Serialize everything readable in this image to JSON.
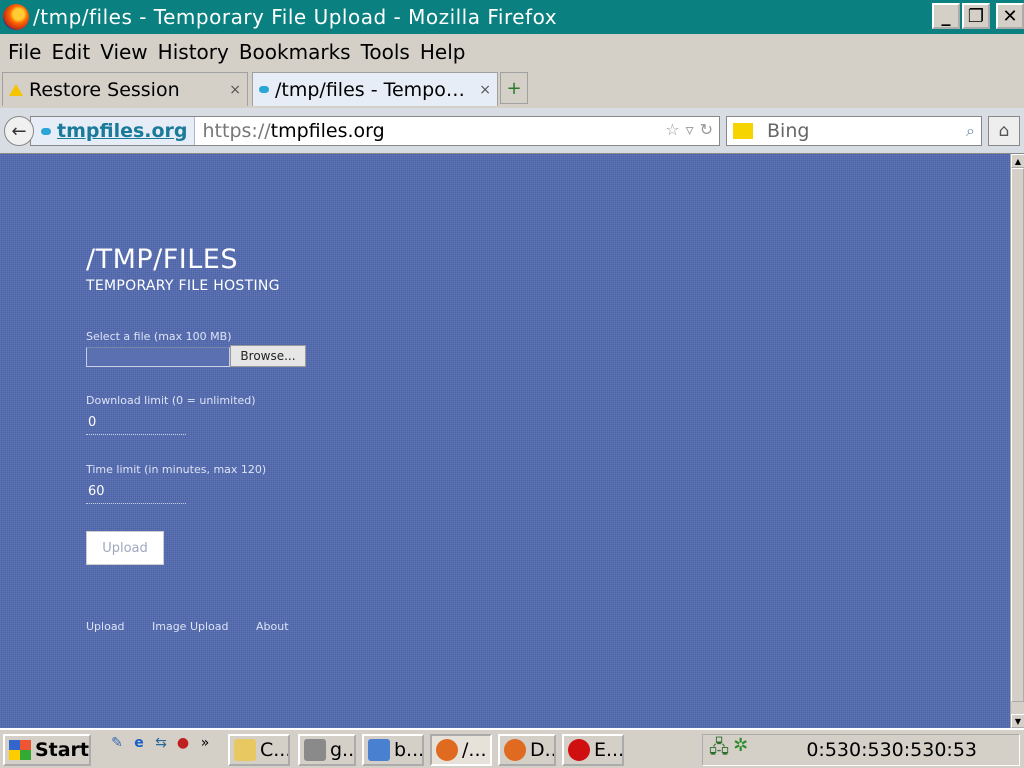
{
  "window": {
    "title": "/tmp/files - Temporary File Upload - Mozilla Firefox",
    "minimize": "_",
    "maximize": "❐",
    "close": "✕"
  },
  "menu": [
    "File",
    "Edit",
    "View",
    "History",
    "Bookmarks",
    "Tools",
    "Help"
  ],
  "tabs": [
    {
      "label": "Restore Session",
      "icon": "warning-icon",
      "close": "×",
      "active": false
    },
    {
      "label": "/tmp/files - Tempo…",
      "icon": "cloud-icon",
      "close": "×",
      "active": true
    }
  ],
  "new_tab": "+",
  "urlbar": {
    "identity": "tmpfiles.org",
    "scheme": "https://",
    "host": "tmpfiles.org"
  },
  "search": {
    "placeholder": "Bing"
  },
  "page": {
    "title": "/TMP/FILES",
    "subtitle": "TEMPORARY FILE HOSTING",
    "file_label": "Select a file (max 100 MB)",
    "browse": "Browse...",
    "download_label": "Download limit (0 = unlimited)",
    "download_value": "0",
    "time_label": "Time limit (in minutes, max 120)",
    "time_value": "60",
    "upload": "Upload",
    "footer": [
      "Upload",
      "Image Upload",
      "About"
    ]
  },
  "taskbar": {
    "start": "Start",
    "buttons": [
      "C...",
      "g...",
      "b...",
      "/...",
      "D...",
      "E..."
    ],
    "clock": "0:530:530:530:53"
  },
  "colors": {
    "titlebar": "#0a8080",
    "page_bg": "#4b63a8",
    "taskbar": "#d4d0c8"
  }
}
